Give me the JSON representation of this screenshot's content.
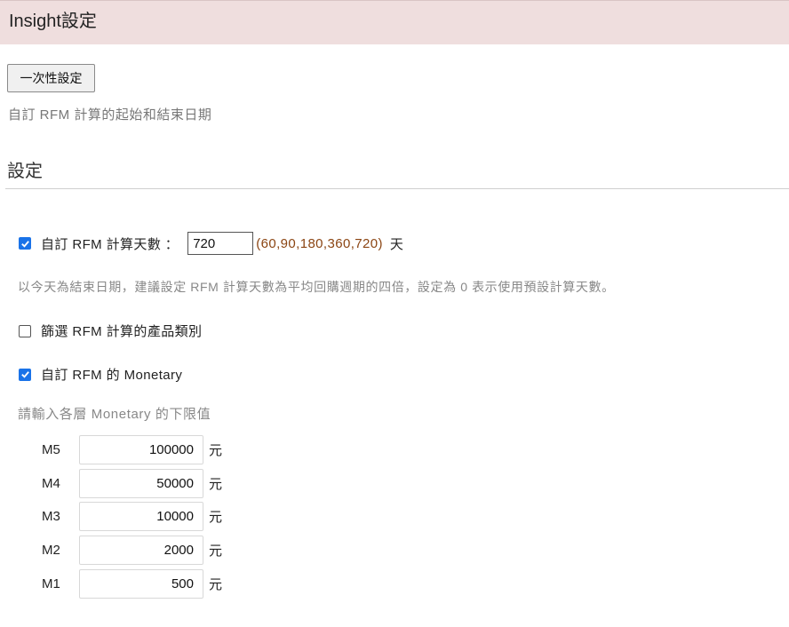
{
  "header": {
    "title": "Insight設定"
  },
  "once": {
    "button_label": "一次性設定",
    "description": "自訂 RFM 計算的起始和結束日期"
  },
  "settings": {
    "section_title": "設定",
    "custom_days": {
      "checked": true,
      "label": "自訂 RFM 計算天數 ：",
      "value": "720",
      "options_text": "(60,90,180,360,720)",
      "unit": "天",
      "hint": "以今天為結束日期，建議設定 RFM 計算天數為平均回購週期的四倍，設定為 0 表示使用預設計算天數。"
    },
    "filter_category": {
      "checked": false,
      "label": "篩選 RFM 計算的產品類別"
    },
    "custom_monetary": {
      "checked": true,
      "label": "自訂 RFM 的 Monetary",
      "hint": "請輸入各層 Monetary 的下限值",
      "levels": [
        {
          "label": "M5",
          "value": "100000",
          "unit": "元"
        },
        {
          "label": "M4",
          "value": "50000",
          "unit": "元"
        },
        {
          "label": "M3",
          "value": "10000",
          "unit": "元"
        },
        {
          "label": "M2",
          "value": "2000",
          "unit": "元"
        },
        {
          "label": "M1",
          "value": "500",
          "unit": "元"
        }
      ]
    }
  },
  "colors": {
    "header_bg": "#efdede",
    "checkbox_accent": "#1a73e8",
    "options_text": "#8b4513"
  }
}
